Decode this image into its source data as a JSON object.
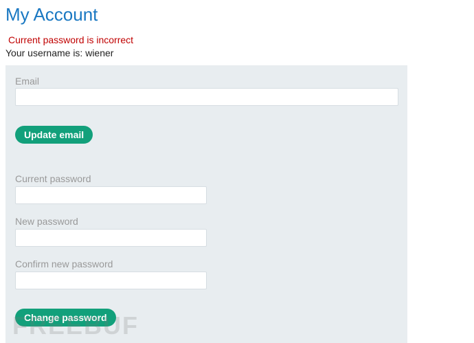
{
  "page": {
    "title": "My Account",
    "error_message": "Current password is incorrect",
    "username_text": "Your username is: wiener"
  },
  "email_form": {
    "label": "Email",
    "value": "",
    "button_label": "Update email"
  },
  "password_form": {
    "current_label": "Current password",
    "current_value": "",
    "new_label": "New password",
    "new_value": "",
    "confirm_label": "Confirm new password",
    "confirm_value": "",
    "button_label": "Change password"
  },
  "watermark": {
    "text": "FREEBUF"
  },
  "colors": {
    "title": "#1a78c2",
    "error": "#c00000",
    "panel_bg": "#e8edf0",
    "button_bg": "#12a07b"
  }
}
